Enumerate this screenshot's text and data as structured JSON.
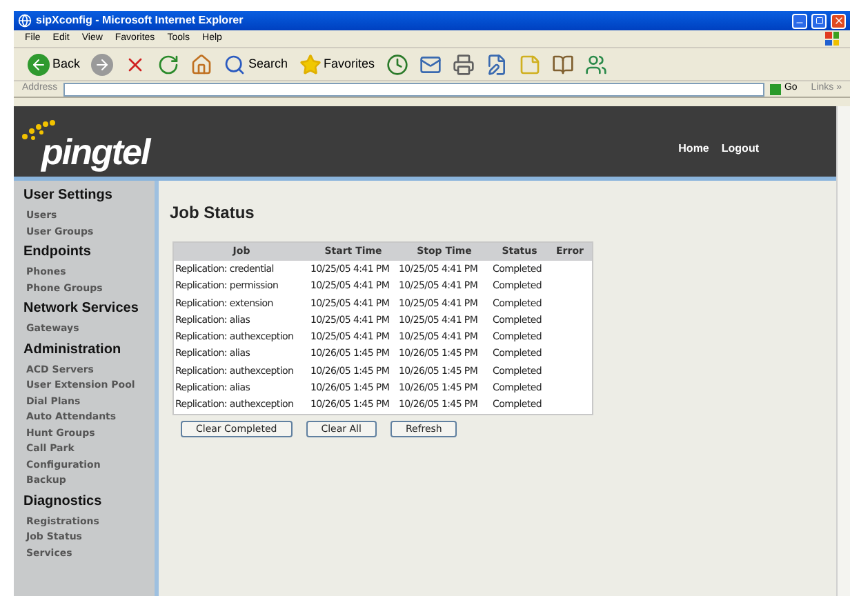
{
  "window": {
    "title": "sipXconfig - Microsoft Internet Explorer"
  },
  "menu": [
    "File",
    "Edit",
    "View",
    "Favorites",
    "Tools",
    "Help"
  ],
  "toolbar": [
    {
      "kind": "back",
      "label": "Back"
    },
    {
      "kind": "forward"
    },
    {
      "kind": "stop"
    },
    {
      "kind": "refresh"
    },
    {
      "kind": "home"
    },
    {
      "kind": "search",
      "label": "Search"
    },
    {
      "kind": "favorites",
      "label": "Favorites"
    },
    {
      "kind": "media"
    },
    {
      "kind": "mail"
    },
    {
      "kind": "print"
    },
    {
      "kind": "edit"
    },
    {
      "kind": "note"
    },
    {
      "kind": "research"
    },
    {
      "kind": "messenger"
    }
  ],
  "address": {
    "label": "Address",
    "go": "Go",
    "links": "Links",
    "links_more": "»"
  },
  "header": {
    "logo": "pingtel",
    "links": [
      "Home",
      "Logout"
    ]
  },
  "sidebar": [
    {
      "title": "User Settings",
      "items": [
        "Users",
        "User Groups"
      ]
    },
    {
      "title": "Endpoints",
      "items": [
        "Phones",
        "Phone Groups"
      ]
    },
    {
      "title": "Network Services",
      "items": [
        "Gateways"
      ]
    },
    {
      "title": "Administration",
      "items": [
        "ACD Servers",
        "User Extension Pool",
        "Dial Plans",
        "Auto Attendants",
        "Hunt Groups",
        "Call Park",
        "Configuration",
        "Backup"
      ]
    },
    {
      "title": "Diagnostics",
      "items": [
        "Registrations",
        "Job Status",
        "Services"
      ]
    }
  ],
  "page_title": "Job Status",
  "table": {
    "columns": [
      "Job",
      "Start Time",
      "Stop Time",
      "Status",
      "Error"
    ],
    "rows": [
      [
        "Replication: credential",
        "10/25/05 4:41 PM",
        "10/25/05 4:41 PM",
        "Completed",
        ""
      ],
      [
        "Replication: permission",
        "10/25/05 4:41 PM",
        "10/25/05 4:41 PM",
        "Completed",
        ""
      ],
      [
        "Replication: extension",
        "10/25/05 4:41 PM",
        "10/25/05 4:41 PM",
        "Completed",
        ""
      ],
      [
        "Replication: alias",
        "10/25/05 4:41 PM",
        "10/25/05 4:41 PM",
        "Completed",
        ""
      ],
      [
        "Replication: authexception",
        "10/25/05 4:41 PM",
        "10/25/05 4:41 PM",
        "Completed",
        ""
      ],
      [
        "Replication: alias",
        "10/26/05 1:45 PM",
        "10/26/05 1:45 PM",
        "Completed",
        ""
      ],
      [
        "Replication: authexception",
        "10/26/05 1:45 PM",
        "10/26/05 1:45 PM",
        "Completed",
        ""
      ],
      [
        "Replication: alias",
        "10/26/05 1:45 PM",
        "10/26/05 1:45 PM",
        "Completed",
        ""
      ],
      [
        "Replication: authexception",
        "10/26/05 1:45 PM",
        "10/26/05 1:45 PM",
        "Completed",
        ""
      ]
    ]
  },
  "buttons": [
    "Clear Completed",
    "Clear All",
    "Refresh"
  ]
}
